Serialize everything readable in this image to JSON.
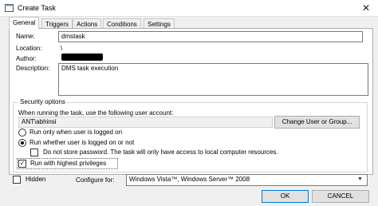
{
  "window": {
    "title": "Create Task",
    "close_icon": "close-icon"
  },
  "tabs": [
    "General",
    "Triggers",
    "Actions",
    "Conditions",
    "Settings"
  ],
  "general": {
    "name_label": "Name:",
    "name_value": "dmstask",
    "location_label": "Location:",
    "location_value": "\\",
    "author_label": "Author:",
    "description_label": "Description:",
    "description_value": "DMS task execution"
  },
  "security": {
    "title": "Security options",
    "account_prompt": "When running the task, use the following user account:",
    "account_value": "ANT\\abhinsi",
    "change_button": "Change User or Group...",
    "radio_logged_on": "Run only when user is logged on",
    "radio_logged_on_or_not": "Run whether user is logged on or not",
    "selected_radio": "Run whether user is logged on or not",
    "no_store_password": "Do not store password.  The task will only have access to local computer resources.",
    "no_store_password_checked": false,
    "highest_privileges": "Run with highest privileges",
    "highest_privileges_checked": true
  },
  "footer": {
    "hidden_label": "Hidden",
    "hidden_checked": false,
    "configure_label": "Configure for:",
    "configure_value": "Windows Vista™, Windows Server™ 2008",
    "ok_button": "OK",
    "cancel_button": "CANCEL"
  }
}
